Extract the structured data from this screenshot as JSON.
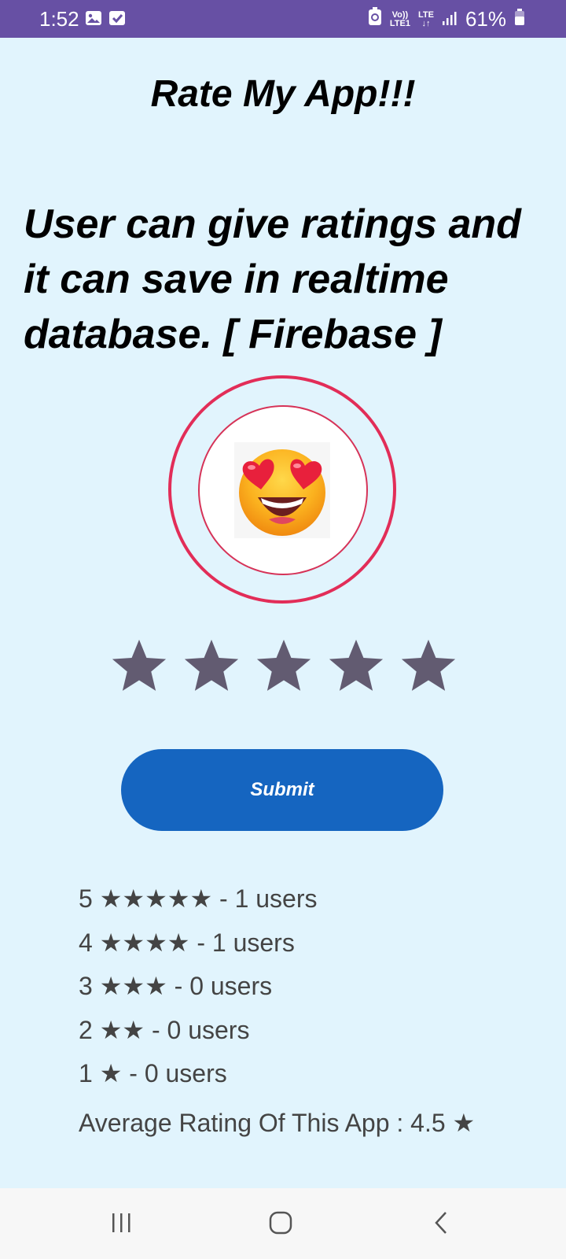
{
  "status_bar": {
    "time": "1:52",
    "network_top": "Vo))",
    "network_bottom": "LTE1",
    "lte_label": "LTE",
    "battery": "61%",
    "icons": [
      "gallery-icon",
      "checkbox-icon",
      "data-saver-icon",
      "signal-icon",
      "battery-icon"
    ]
  },
  "header": {
    "title": "Rate My App!!!"
  },
  "description": "User can give ratings and it can save in realtime database. [ Firebase ]",
  "emoji": {
    "icon": "heart-eyes-emoji-icon"
  },
  "rating_bar": {
    "max": 5,
    "color": "#625b71"
  },
  "submit": {
    "label": "Submit",
    "color": "#1565c0"
  },
  "stats": {
    "rows": [
      {
        "label": "5 ★★★★★ - 1 users"
      },
      {
        "label": "4 ★★★★ - 1 users"
      },
      {
        "label": "3 ★★★ - 0 users"
      },
      {
        "label": "2 ★★ - 0 users"
      },
      {
        "label": "1 ★ - 0 users"
      }
    ],
    "average": "Average Rating Of This App : 4.5 ★"
  },
  "nav": {
    "icons": [
      "recent-apps-icon",
      "home-icon",
      "back-icon"
    ]
  },
  "colors": {
    "status_bar": "#6750a4",
    "background": "#e1f4fd",
    "ring": "#e22d58"
  }
}
